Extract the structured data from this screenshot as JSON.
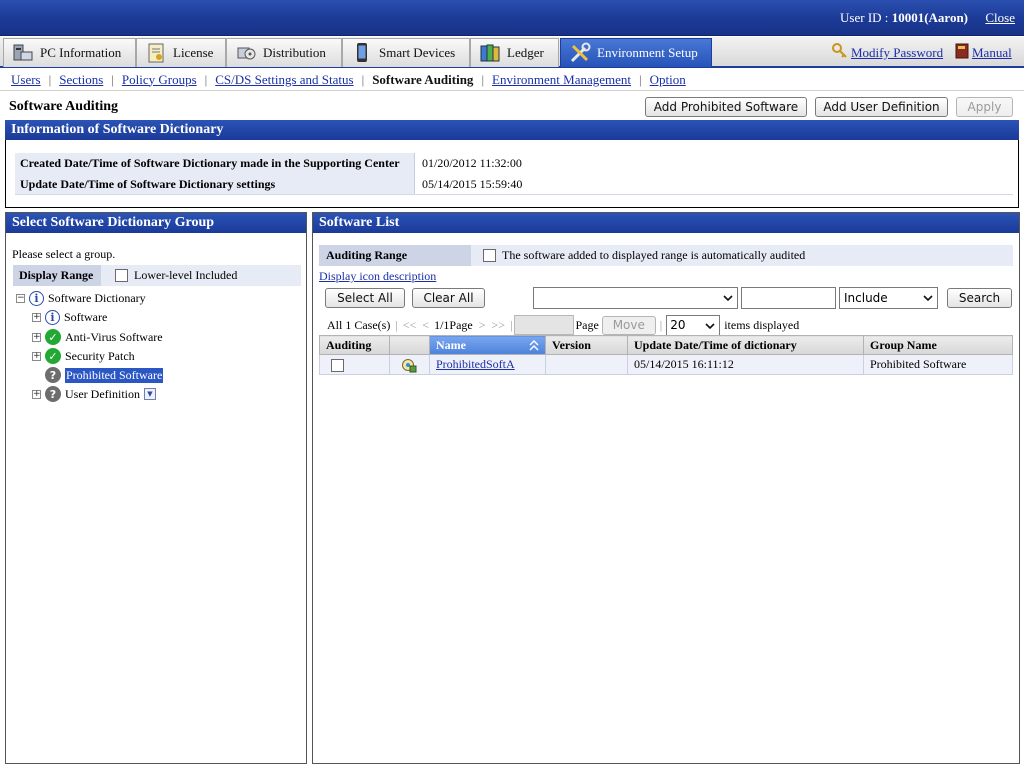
{
  "header": {
    "userid_label": "User ID : ",
    "userid_value": "10001(Aaron)",
    "close_label": "Close"
  },
  "tabs": [
    {
      "label": "PC Information",
      "icon": "pc-icon"
    },
    {
      "label": "License",
      "icon": "license-icon"
    },
    {
      "label": "Distribution",
      "icon": "distribution-icon"
    },
    {
      "label": "Smart Devices",
      "icon": "smart-device-icon"
    },
    {
      "label": "Ledger",
      "icon": "ledger-icon"
    },
    {
      "label": "Environment Setup",
      "icon": "tools-icon",
      "active": true
    }
  ],
  "tab_links": {
    "modify_password": "Modify Password",
    "manual": "Manual"
  },
  "subnav": {
    "items": [
      "Users",
      "Sections",
      "Policy Groups",
      "CS/DS Settings and Status",
      "Software Auditing",
      "Environment Management",
      "Option"
    ],
    "current": "Software Auditing"
  },
  "page": {
    "title": "Software Auditing",
    "buttons": {
      "add_prohibited": "Add Prohibited Software",
      "add_user_def": "Add User Definition",
      "apply": "Apply"
    }
  },
  "dictionary_info": {
    "section_title": "Information of Software Dictionary",
    "rows": [
      {
        "label": "Created Date/Time of Software Dictionary made in the Supporting Center",
        "value": "01/20/2012 11:32:00"
      },
      {
        "label": "Update Date/Time of Software Dictionary settings",
        "value": "05/14/2015 15:59:40"
      }
    ]
  },
  "left_panel": {
    "title": "Select Software Dictionary Group",
    "prompt": "Please select a group.",
    "display_range_label": "Display Range",
    "lower_level_label": "Lower-level Included",
    "tree": {
      "root": "Software Dictionary",
      "children": [
        {
          "label": "Software",
          "icon": "info-icon",
          "expandable": true
        },
        {
          "label": "Anti-Virus Software",
          "icon": "check-icon",
          "expandable": true
        },
        {
          "label": "Security Patch",
          "icon": "check-icon",
          "expandable": true
        },
        {
          "label": "Prohibited Software",
          "icon": "question-icon",
          "expandable": false,
          "selected": true
        },
        {
          "label": "User Definition",
          "icon": "question-icon",
          "expandable": true
        }
      ]
    }
  },
  "right_panel": {
    "title": "Software List",
    "auditing_range_label": "Auditing Range",
    "auditing_range_text": "The software added to displayed range is automatically audited",
    "icon_desc_link": "Display icon description",
    "select_all": "Select All",
    "clear_all": "Clear All",
    "filter": {
      "field_value": "",
      "text_value": "",
      "match_value": "Include",
      "search_label": "Search"
    },
    "pager": {
      "count_text": "All 1 Case(s)",
      "first": "<<",
      "prev": "<",
      "page_text": "1/1Page",
      "next": ">",
      "last": ">>",
      "page_input": "",
      "page_label": "Page",
      "move_label": "Move",
      "per_page": "20",
      "items_displayed": "items displayed"
    },
    "table": {
      "columns": [
        "Auditing",
        "",
        "Name",
        "Version",
        "Update Date/Time of dictionary",
        "Group Name"
      ],
      "rows": [
        {
          "auditing": false,
          "icon": "software-icon",
          "name": "ProhibitedSoftA",
          "version": "",
          "updated": "05/14/2015 16:11:12",
          "group": "Prohibited Software"
        }
      ]
    }
  }
}
